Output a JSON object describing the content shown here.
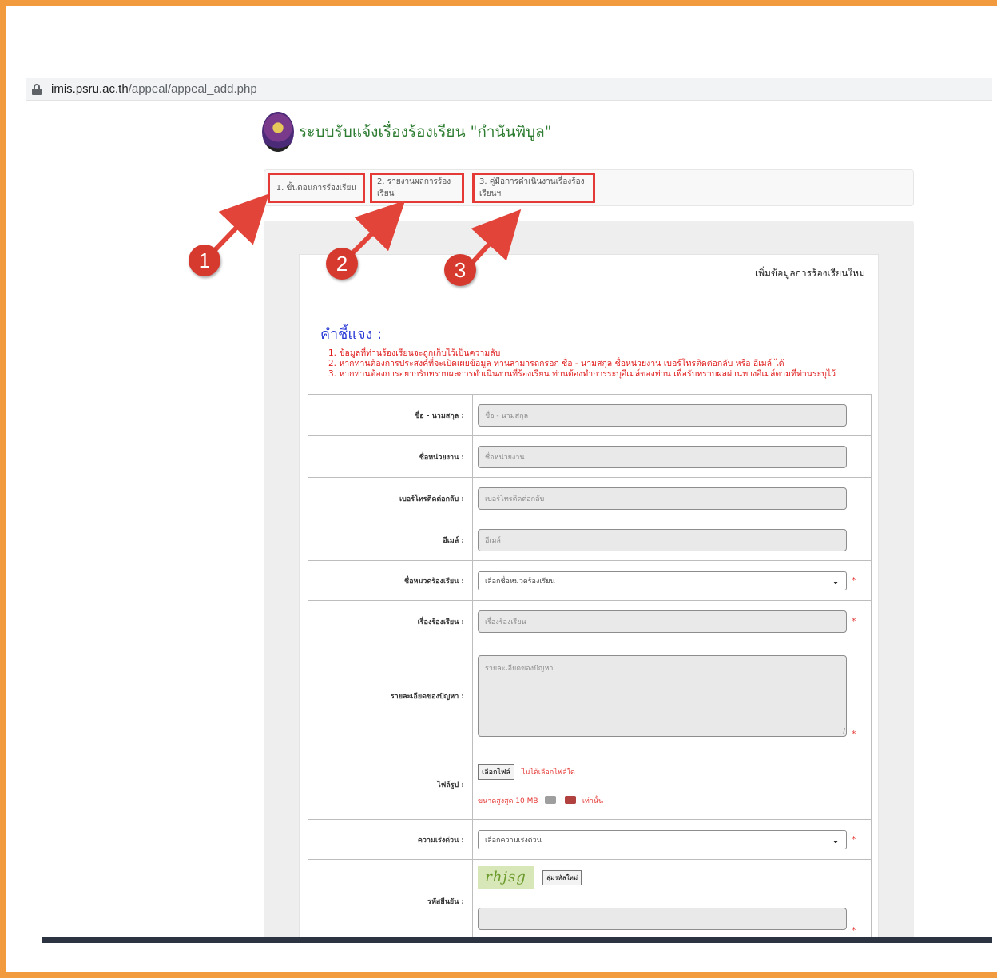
{
  "browser": {
    "url_host": "imis.psru.ac.th",
    "url_path": "/appeal/appeal_add.php"
  },
  "site": {
    "title": "ระบบรับแจ้งเรื่องร้องเรียน \"กำนันพิบูล\""
  },
  "nav": {
    "tabs": [
      {
        "label": "1. ขั้นตอนการร้องเรียน"
      },
      {
        "label": "2. รายงานผลการร้องเรียน"
      },
      {
        "label": "3. คู่มือการดำเนินงานเรื่องร้องเรียนฯ"
      }
    ]
  },
  "annotations": {
    "badges": [
      "1",
      "2",
      "3"
    ],
    "color": "#d63a2f"
  },
  "form": {
    "title": "เพิ่มข้อมูลการร้องเรียนใหม่",
    "instructions_title": "คำชี้แจง :",
    "instructions": [
      "1. ข้อมูลที่ท่านร้องเรียนจะถูกเก็บไว้เป็นความลับ",
      "2. หากท่านต้องการประสงค์ที่จะเปิดเผยข้อมูล ท่านสามารถกรอก ชื่อ - นามสกุล ชื่อหน่วยงาน เบอร์โทรติดต่อกลับ หรือ อีเมล์ ได้",
      "3. หากท่านต้องการอยากรับทราบผลการดำเนินงานที่ร้องเรียน ท่านต้องทำการระบุอีเมล์ของท่าน เพื่อรับทราบผลผ่านทางอีเมล์ตามที่ท่านระบุไว้"
    ],
    "fields": {
      "name": {
        "label": "ชื่อ - นามสกุล :",
        "placeholder": "ชื่อ - นามสกุล"
      },
      "org": {
        "label": "ชื่อหน่วยงาน :",
        "placeholder": "ชื่อหน่วยงาน"
      },
      "phone": {
        "label": "เบอร์โทรติดต่อกลับ :",
        "placeholder": "เบอร์โทรติดต่อกลับ"
      },
      "email": {
        "label": "อีเมล์ :",
        "placeholder": "อีเมล์"
      },
      "category": {
        "label": "ชื่อหมวดร้องเรียน :",
        "selected": "เลือกชื่อหมวดร้องเรียน"
      },
      "subject": {
        "label": "เรื่องร้องเรียน :",
        "placeholder": "เรื่องร้องเรียน"
      },
      "detail": {
        "label": "รายละเอียดของปัญหา :",
        "placeholder": "รายละเอียดของปัญหา"
      },
      "file": {
        "label": "ไฟล์รูป :",
        "button": "เลือกไฟล์",
        "status": "ไม่ได้เลือกไฟล์ใด",
        "hint_prefix": "ขนาดสูงสุด 10 MB",
        "hint_suffix": "เท่านั้น"
      },
      "urgency": {
        "label": "ความเร่งด่วน :",
        "selected": "เลือกความเร่งด่วน"
      },
      "captcha": {
        "label": "รหัสยืนยัน :",
        "code": "rhjsg",
        "refresh": "สุ่มรหัสใหม่"
      }
    },
    "required_mark": "*"
  }
}
